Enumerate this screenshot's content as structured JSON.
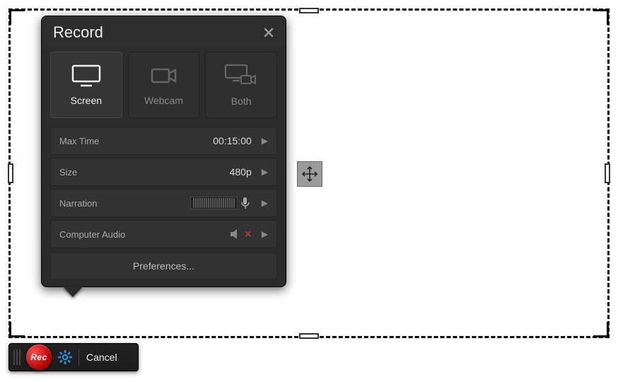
{
  "panel": {
    "title": "Record",
    "modes": {
      "screen": "Screen",
      "webcam": "Webcam",
      "both": "Both",
      "active": "screen"
    },
    "settings": {
      "max_time": {
        "label": "Max Time",
        "value": "00:15:00"
      },
      "size": {
        "label": "Size",
        "value": "480p"
      },
      "narration": {
        "label": "Narration"
      },
      "computer_audio": {
        "label": "Computer Audio",
        "muted": true
      }
    },
    "preferences_label": "Preferences..."
  },
  "controls": {
    "rec_label": "Rec",
    "cancel_label": "Cancel"
  },
  "colors": {
    "accent_blue": "#2f88d6",
    "rec_red": "#d81414"
  }
}
